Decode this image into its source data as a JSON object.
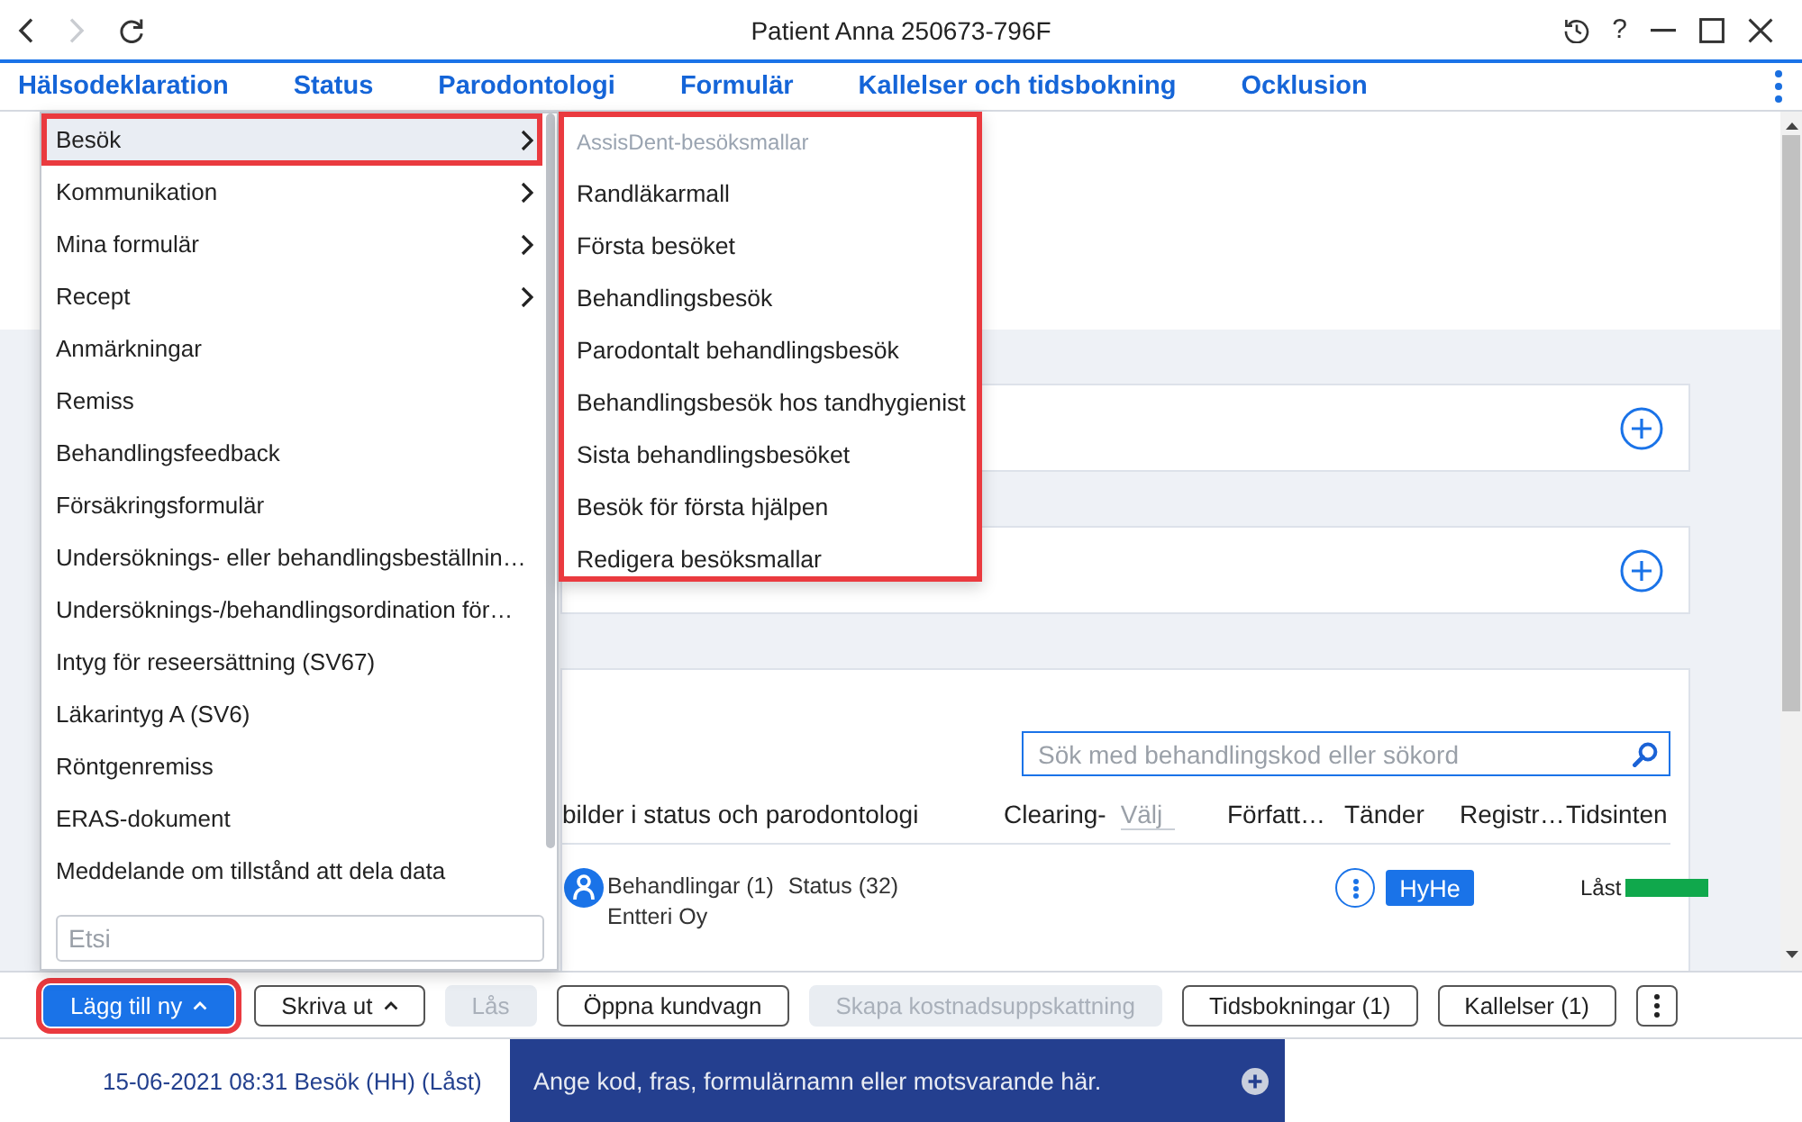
{
  "window": {
    "title": "Patient Anna 250673-796F",
    "back_disabled": false,
    "forward_disabled": true,
    "help_label": "?"
  },
  "tabs": [
    {
      "label": "Hälsodeklaration"
    },
    {
      "label": "Status"
    },
    {
      "label": "Parodontologi"
    },
    {
      "label": "Formulär"
    },
    {
      "label": "Kallelser och tidsbokning"
    },
    {
      "label": "Ocklusion"
    }
  ],
  "add_menu": {
    "items": [
      {
        "label": "Besök",
        "kind": "submenu",
        "selected": true,
        "highlighted": true
      },
      {
        "label": "Kommunikation",
        "kind": "submenu",
        "selected": false,
        "highlighted": false
      },
      {
        "label": "Mina formulär",
        "kind": "submenu",
        "selected": false,
        "highlighted": false
      },
      {
        "label": "Recept",
        "kind": "submenu",
        "selected": false,
        "highlighted": false
      },
      {
        "label": "Anmärkningar",
        "kind": "action",
        "selected": false,
        "highlighted": false
      },
      {
        "label": "Remiss",
        "kind": "action",
        "selected": false,
        "highlighted": false
      },
      {
        "label": "Behandlingsfeedback",
        "kind": "action",
        "selected": false,
        "highlighted": false
      },
      {
        "label": "Försäkringsformulär",
        "kind": "action",
        "selected": false,
        "highlighted": false
      },
      {
        "label": "Undersöknings- eller behandlingsbeställnin…",
        "kind": "action",
        "selected": false,
        "highlighted": false
      },
      {
        "label": "Undersöknings-/behandlingsordination för…",
        "kind": "action",
        "selected": false,
        "highlighted": false
      },
      {
        "label": "Intyg för reseersättning (SV67)",
        "kind": "action",
        "selected": false,
        "highlighted": false
      },
      {
        "label": "Läkarintyg A (SV6)",
        "kind": "action",
        "selected": false,
        "highlighted": false
      },
      {
        "label": "Röntgenremiss",
        "kind": "action",
        "selected": false,
        "highlighted": false
      },
      {
        "label": "ERAS-dokument",
        "kind": "action",
        "selected": false,
        "highlighted": false
      },
      {
        "label": "Meddelande om tillstånd att dela data",
        "kind": "action",
        "selected": false,
        "highlighted": false
      }
    ],
    "search": {
      "placeholder": "Etsi"
    }
  },
  "submenu": {
    "highlighted": true,
    "heading": "AssisDent-besöksmallar",
    "items": [
      {
        "label": "Randläkarmall"
      },
      {
        "label": "Första besöket"
      },
      {
        "label": "Behandlingsbesök"
      },
      {
        "label": "Parodontalt behandlingsbesök"
      },
      {
        "label": "Behandlingsbesök hos tandhygienist"
      },
      {
        "label": "Sista behandlingsbesöket"
      },
      {
        "label": "Besök för första hjälpen"
      },
      {
        "label": "Redigera besöksmallar"
      }
    ]
  },
  "treatment_panel": {
    "search": {
      "placeholder": "Sök med behandlingskod eller sökord"
    },
    "columns": [
      {
        "label": "bilder i status och parodontologi",
        "kind": "text"
      },
      {
        "label": "Clearing-",
        "kind": "filter",
        "placeholder": "Välj"
      },
      {
        "label": "Författ…",
        "kind": "text"
      },
      {
        "label": "Tänder",
        "kind": "text"
      },
      {
        "label": "Registr…",
        "kind": "text"
      },
      {
        "label": "Tidsinten",
        "kind": "text"
      }
    ],
    "rows": [
      {
        "treatments": "Behandlingar (1)",
        "status": "Status (32)",
        "provider": "Entteri Oy",
        "author": "HyHe",
        "lock": "Låst",
        "color": "#10a84c"
      }
    ]
  },
  "toolbar": {
    "buttons": [
      {
        "label": "Lägg till ny",
        "kind": "primary",
        "has_menu": true,
        "disabled": false,
        "highlighted": true
      },
      {
        "label": "Skriva ut",
        "kind": "secondary",
        "has_menu": true,
        "disabled": false,
        "highlighted": false
      },
      {
        "label": "Lås",
        "kind": "secondary",
        "has_menu": false,
        "disabled": true,
        "highlighted": false
      },
      {
        "label": "Öppna kundvagn",
        "kind": "secondary",
        "has_menu": false,
        "disabled": false,
        "highlighted": false
      },
      {
        "label": "Skapa kostnadsuppskattning",
        "kind": "secondary",
        "has_menu": false,
        "disabled": true,
        "highlighted": false
      },
      {
        "label": "Tidsbokningar (1)",
        "kind": "secondary",
        "has_menu": false,
        "disabled": false,
        "highlighted": false
      },
      {
        "label": "Kallelser (1)",
        "kind": "secondary",
        "has_menu": false,
        "disabled": false,
        "highlighted": false
      },
      {
        "kind": "more",
        "has_menu": false,
        "disabled": false,
        "highlighted": false
      }
    ]
  },
  "status_bar": {
    "visit": "15-06-2021 08:31 Besök (HH) (Låst)",
    "command_field": {
      "placeholder": "Ange kod, fras, formulärnamn eller motsvarande här."
    }
  }
}
